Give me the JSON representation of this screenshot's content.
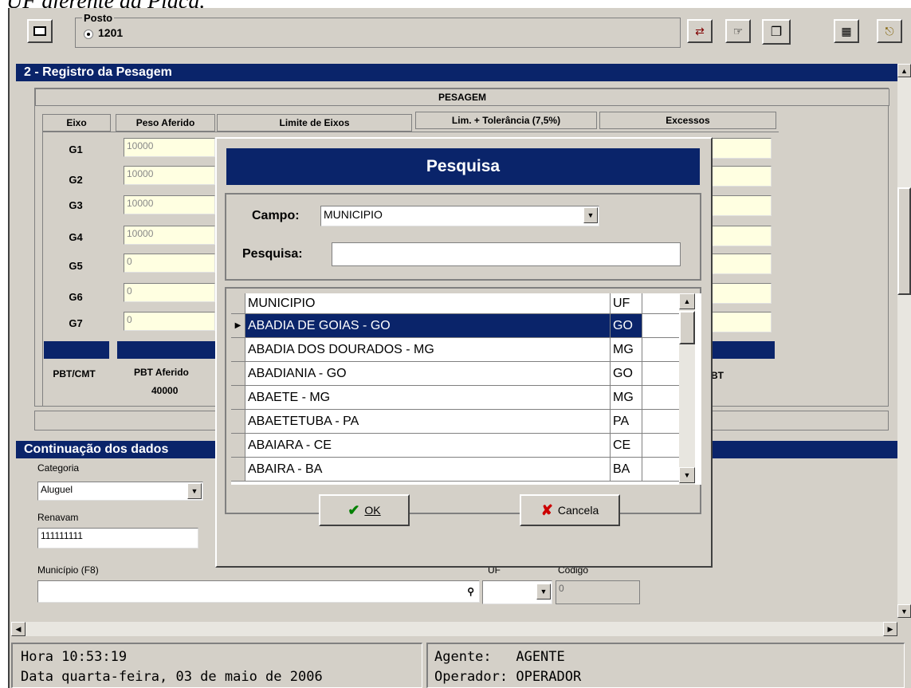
{
  "top_caption": "UF aferente da Placa.",
  "toolbar": {
    "posto_label": "Posto",
    "posto_value": "1201"
  },
  "section1": {
    "title": "2 - Registro da Pesagem",
    "pesagem": "PESAGEM",
    "headers": [
      "Eixo",
      "Peso Aferido",
      "Limite de Eixos",
      "Lim. + Tolerância (7,5%)",
      "Excessos"
    ],
    "groups": [
      {
        "label": "G1",
        "peso": "10000"
      },
      {
        "label": "G2",
        "peso": "10000"
      },
      {
        "label": "G3",
        "peso": "10000"
      },
      {
        "label": "G4",
        "peso": "10000"
      },
      {
        "label": "G5",
        "peso": "0"
      },
      {
        "label": "G6",
        "peso": "0"
      },
      {
        "label": "G7",
        "peso": "0"
      }
    ],
    "pbt_cmt": "PBT/CMT",
    "pbt_aferido": "PBT Aferido",
    "pbt_value": "40000",
    "pbt_right": "BT"
  },
  "section2": {
    "title": "Continuação dos dados",
    "categoria_label": "Categoria",
    "categoria_value": "Aluguel",
    "renavam_label": "Renavam",
    "renavam_value": "111111111",
    "municipio_label": "Município (F8)",
    "uf_label": "UF",
    "codigo_label": "Código",
    "codigo_value": "0"
  },
  "status": {
    "hora": "Hora 10:53:19",
    "data": "Data quarta-feira, 03 de maio de 2006",
    "agente": "Agente:   AGENTE",
    "operador": "Operador: OPERADOR"
  },
  "dialog": {
    "title": "Pesquisa",
    "campo_label": "Campo:",
    "campo_value": "MUNICIPIO",
    "pesquisa_label": "Pesquisa:",
    "pesquisa_value": "",
    "columns": [
      "MUNICIPIO",
      "UF"
    ],
    "rows": [
      {
        "municipio": "ABADIA DE GOIAS - GO",
        "uf": "GO"
      },
      {
        "municipio": "ABADIA DOS DOURADOS - MG",
        "uf": "MG"
      },
      {
        "municipio": "ABADIANIA - GO",
        "uf": "GO"
      },
      {
        "municipio": "ABAETE - MG",
        "uf": "MG"
      },
      {
        "municipio": "ABAETETUBA - PA",
        "uf": "PA"
      },
      {
        "municipio": "ABAIARA - CE",
        "uf": "CE"
      },
      {
        "municipio": "ABAIRA - BA",
        "uf": "BA"
      }
    ],
    "ok_label": "OK",
    "cancel_label": "Cancela"
  }
}
